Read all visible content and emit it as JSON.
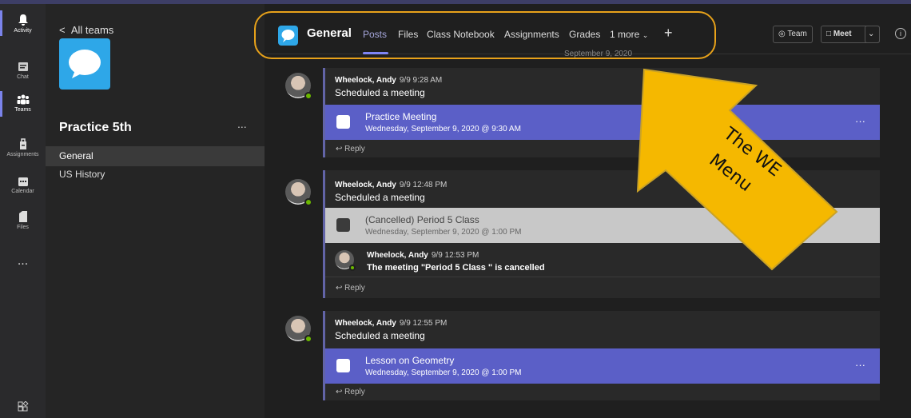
{
  "rail": [
    {
      "label": "Activity",
      "icon": "bell-icon"
    },
    {
      "label": "Chat",
      "icon": "chat-icon"
    },
    {
      "label": "Teams",
      "icon": "teams-icon"
    },
    {
      "label": "Assignments",
      "icon": "assignments-icon"
    },
    {
      "label": "Calendar",
      "icon": "calendar-icon"
    },
    {
      "label": "Files",
      "icon": "files-icon"
    },
    {
      "label": "...",
      "icon": "more-icon"
    }
  ],
  "teams": {
    "back_label": "All teams",
    "team_name": "Practice 5th",
    "more": "...",
    "channels": [
      "General",
      "US History"
    ]
  },
  "header": {
    "channel": "General",
    "tabs": [
      "Posts",
      "Files",
      "Class Notebook",
      "Assignments",
      "Grades",
      "1 more"
    ],
    "add": "+",
    "team_btn": "Team",
    "meet_btn": "Meet",
    "info": "i"
  },
  "date_separator": "September 9, 2020",
  "posts": [
    {
      "author": "Wheelock, Andy",
      "time": "9/9 9:28 AM",
      "text": "Scheduled a meeting",
      "meeting_title": "Practice Meeting",
      "meeting_sub": "Wednesday, September 9, 2020 @ 9:30 AM",
      "reply": "Reply"
    },
    {
      "author": "Wheelock, Andy",
      "time": "9/9 12:48 PM",
      "text": "Scheduled a meeting",
      "meeting_title": "(Cancelled) Period 5 Class",
      "meeting_sub": "Wednesday, September 9, 2020 @ 1:00 PM",
      "reply_author": "Wheelock, Andy",
      "reply_time": "9/9 12:53 PM",
      "reply_text": "The meeting \"Period 5 Class \" is cancelled",
      "reply": "Reply"
    },
    {
      "author": "Wheelock, Andy",
      "time": "9/9 12:55 PM",
      "text": "Scheduled a meeting",
      "meeting_title": "Lesson on Geometry",
      "meeting_sub": "Wednesday, September 9, 2020 @ 1:00 PM",
      "reply": "Reply"
    }
  ],
  "annotation": {
    "line1": "The WE",
    "line2": "Menu",
    "color": "#f5b800"
  }
}
